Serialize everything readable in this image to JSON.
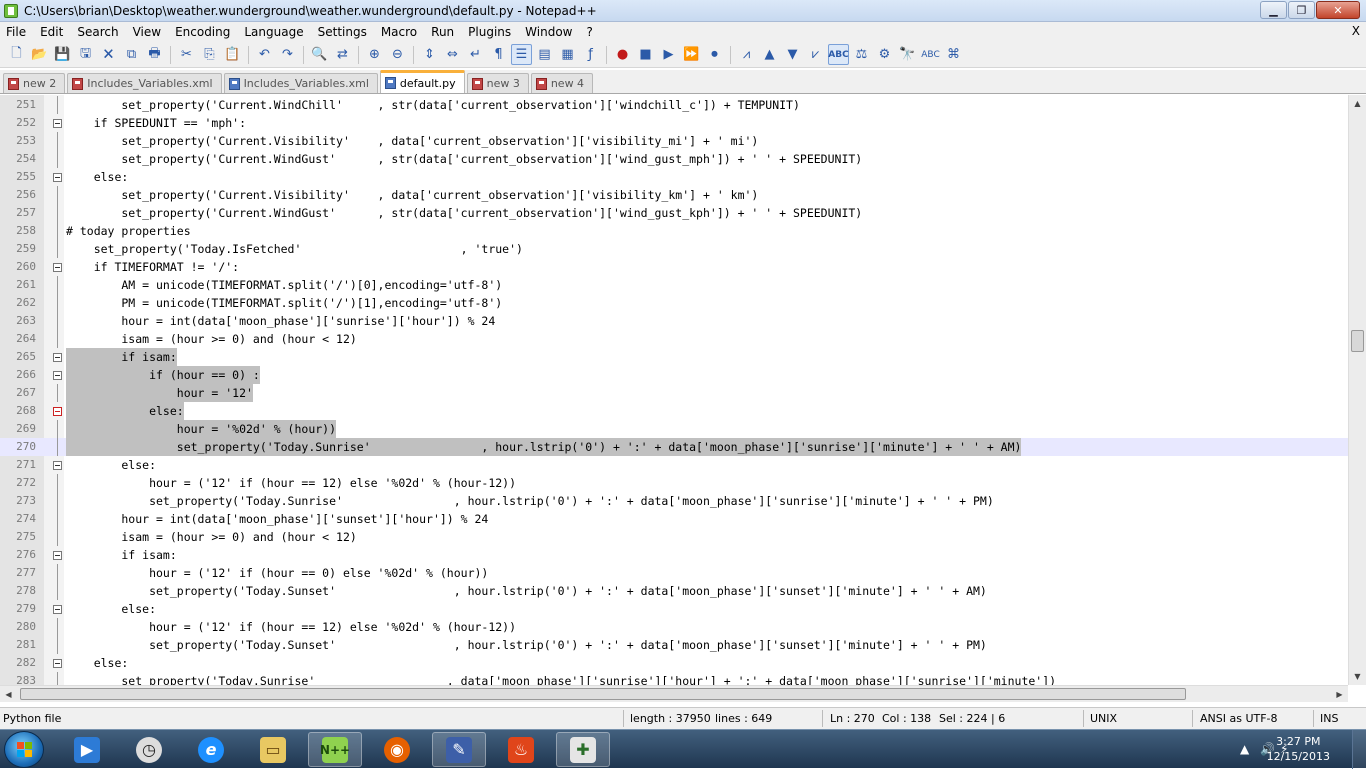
{
  "window": {
    "title": "C:\\Users\\brian\\Desktop\\weather.wunderground\\weather.wunderground\\default.py - Notepad++",
    "minimize": "▁",
    "maximize": "❐",
    "close": "✕"
  },
  "menu": {
    "items": [
      "File",
      "Edit",
      "Search",
      "View",
      "Encoding",
      "Language",
      "Settings",
      "Macro",
      "Run",
      "Plugins",
      "Window",
      "?"
    ],
    "close_label": "X"
  },
  "tabs": [
    {
      "label": "new  2",
      "unsaved": true
    },
    {
      "label": "Includes_Variables.xml",
      "unsaved": true
    },
    {
      "label": "Includes_Variables.xml",
      "unsaved": false
    },
    {
      "label": "default.py",
      "active": true,
      "unsaved": false
    },
    {
      "label": "new  3",
      "unsaved": true
    },
    {
      "label": "new  4",
      "unsaved": true
    }
  ],
  "editor": {
    "lines": [
      {
        "n": "251",
        "code": "        set_property('Current.WindChill'     , str(data['current_observation']['windchill_c']) + TEMPUNIT)",
        "fold": "line"
      },
      {
        "n": "252",
        "code": "    if SPEEDUNIT == 'mph':",
        "fold": "box"
      },
      {
        "n": "253",
        "code": "        set_property('Current.Visibility'    , data['current_observation']['visibility_mi'] + ' mi')",
        "fold": "line"
      },
      {
        "n": "254",
        "code": "        set_property('Current.WindGust'      , str(data['current_observation']['wind_gust_mph']) + ' ' + SPEEDUNIT)",
        "fold": "line"
      },
      {
        "n": "255",
        "code": "    else:",
        "fold": "box"
      },
      {
        "n": "256",
        "code": "        set_property('Current.Visibility'    , data['current_observation']['visibility_km'] + ' km')",
        "fold": "line"
      },
      {
        "n": "257",
        "code": "        set_property('Current.WindGust'      , str(data['current_observation']['wind_gust_kph']) + ' ' + SPEEDUNIT)",
        "fold": "line"
      },
      {
        "n": "258",
        "code": "# today properties",
        "fold": "line"
      },
      {
        "n": "259",
        "code": "    set_property('Today.IsFetched'                       , 'true')",
        "fold": "line"
      },
      {
        "n": "260",
        "code": "    if TIMEFORMAT != '/':",
        "fold": "box"
      },
      {
        "n": "261",
        "code": "        AM = unicode(TIMEFORMAT.split('/')[0],encoding='utf-8')",
        "fold": "line"
      },
      {
        "n": "262",
        "code": "        PM = unicode(TIMEFORMAT.split('/')[1],encoding='utf-8')",
        "fold": "line"
      },
      {
        "n": "263",
        "code": "        hour = int(data['moon_phase']['sunrise']['hour']) % 24",
        "fold": "line"
      },
      {
        "n": "264",
        "code": "        isam = (hour >= 0) and (hour < 12)",
        "fold": "line"
      },
      {
        "n": "265",
        "code": "        if isam:",
        "fold": "box",
        "selected": true
      },
      {
        "n": "266",
        "code": "            if (hour == 0) :",
        "fold": "box",
        "selected": true
      },
      {
        "n": "267",
        "code": "                hour = '12'",
        "fold": "line",
        "selected": true
      },
      {
        "n": "268",
        "code": "            else:",
        "fold": "boxred",
        "selected": true
      },
      {
        "n": "269",
        "code": "                hour = '%02d' % (hour))",
        "fold": "line",
        "selected": true
      },
      {
        "n": "270",
        "code": "                set_property('Today.Sunrise'                , hour.lstrip('0') + ':' + data['moon_phase']['sunrise']['minute'] + ' ' + AM)",
        "fold": "line",
        "selected": true,
        "caret": true
      },
      {
        "n": "271",
        "code": "        else:",
        "fold": "box"
      },
      {
        "n": "272",
        "code": "            hour = ('12' if (hour == 12) else '%02d' % (hour-12))",
        "fold": "line"
      },
      {
        "n": "273",
        "code": "            set_property('Today.Sunrise'                , hour.lstrip('0') + ':' + data['moon_phase']['sunrise']['minute'] + ' ' + PM)",
        "fold": "line"
      },
      {
        "n": "274",
        "code": "        hour = int(data['moon_phase']['sunset']['hour']) % 24",
        "fold": "line"
      },
      {
        "n": "275",
        "code": "        isam = (hour >= 0) and (hour < 12)",
        "fold": "line"
      },
      {
        "n": "276",
        "code": "        if isam:",
        "fold": "box"
      },
      {
        "n": "277",
        "code": "            hour = ('12' if (hour == 0) else '%02d' % (hour))",
        "fold": "line"
      },
      {
        "n": "278",
        "code": "            set_property('Today.Sunset'                 , hour.lstrip('0') + ':' + data['moon_phase']['sunset']['minute'] + ' ' + AM)",
        "fold": "line"
      },
      {
        "n": "279",
        "code": "        else:",
        "fold": "box"
      },
      {
        "n": "280",
        "code": "            hour = ('12' if (hour == 12) else '%02d' % (hour-12))",
        "fold": "line"
      },
      {
        "n": "281",
        "code": "            set_property('Today.Sunset'                 , hour.lstrip('0') + ':' + data['moon_phase']['sunset']['minute'] + ' ' + PM)",
        "fold": "line"
      },
      {
        "n": "282",
        "code": "    else:",
        "fold": "box"
      },
      {
        "n": "283",
        "code": "        set_property('Today.Sunrise'                   , data['moon_phase']['sunrise']['hour'] + ':' + data['moon_phase']['sunrise']['minute'])",
        "fold": "line"
      }
    ]
  },
  "status": {
    "file_type": "Python file",
    "length": "length : 37950",
    "lines": "lines : 649",
    "ln": "Ln : 270",
    "col": "Col : 138",
    "sel": "Sel : 224 | 6",
    "eol": "UNIX",
    "encoding": "ANSI as UTF-8",
    "mode": "INS"
  },
  "taskbar": {
    "time": "3:27 PM",
    "date": "12/15/2013"
  }
}
